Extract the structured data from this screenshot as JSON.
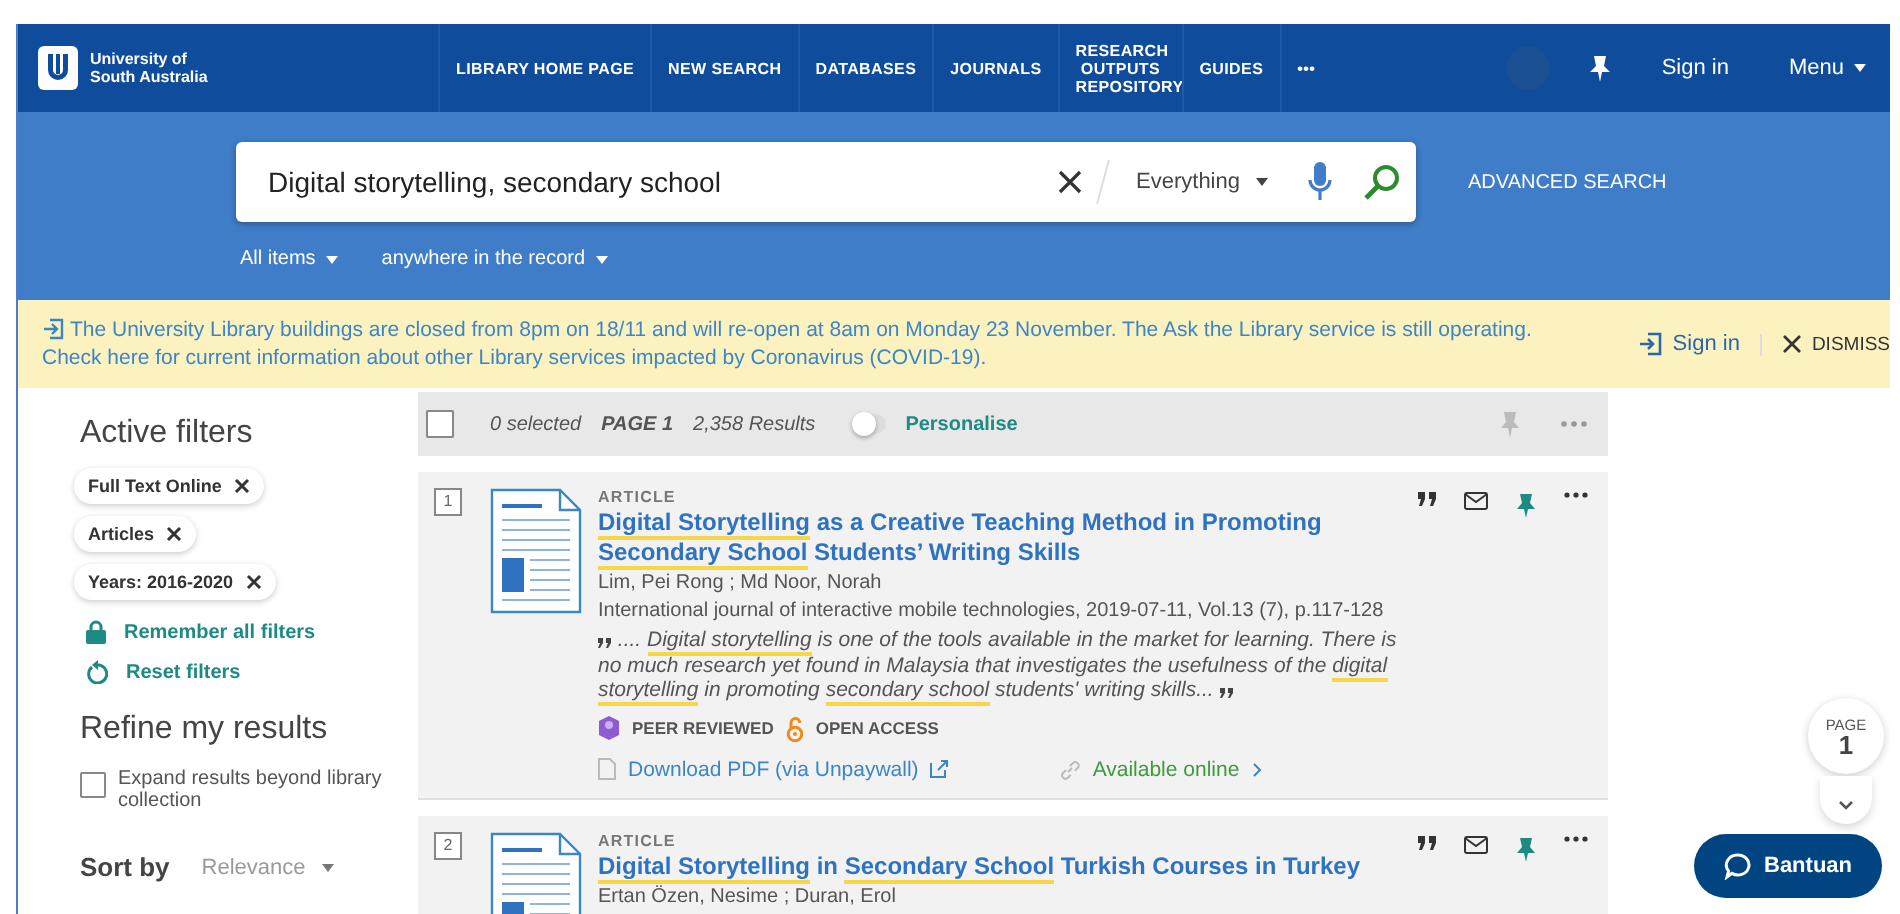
{
  "header": {
    "logo_text": "University of South Australia",
    "nav": [
      {
        "label": "LIBRARY HOME PAGE"
      },
      {
        "label": "NEW SEARCH"
      },
      {
        "label": "DATABASES"
      },
      {
        "label": "JOURNALS"
      },
      {
        "label": "RESEARCH OUTPUTS REPOSITORY"
      },
      {
        "label": "GUIDES"
      },
      {
        "label": "•••"
      }
    ],
    "sign_in": "Sign in",
    "menu": "Menu"
  },
  "search": {
    "value": "Digital storytelling, secondary school",
    "scope": "Everything",
    "advanced": "ADVANCED SEARCH",
    "filters": [
      "All items",
      "anywhere in the record"
    ]
  },
  "notice": {
    "text": "The University Library buildings are closed from 8pm on 18/11 and will re-open at 8am on Monday 23 November. The Ask the Library service is still operating. Check here for current information about other Library services impacted by Coronavirus (COVID-19).",
    "sign_in": "Sign in",
    "dismiss": "DISMISS"
  },
  "sidebar": {
    "active_title": "Active filters",
    "chips": [
      "Full Text Online",
      "Articles",
      "Years: 2016-2020"
    ],
    "remember": "Remember all filters",
    "reset": "Reset filters",
    "refine_title": "Refine my results",
    "expand": {
      "label": "Expand results beyond library collection",
      "checked": false
    },
    "sort_label": "Sort by",
    "sort_value": "Relevance"
  },
  "toolbar": {
    "select_all": {
      "checked": false
    },
    "selected": "0 selected",
    "page": "PAGE 1",
    "results": "2,358 Results",
    "personalise": {
      "label": "Personalise",
      "on": false
    }
  },
  "results": [
    {
      "number": "1",
      "type": "ARTICLE",
      "title": [
        {
          "text": "Digital Storytelling",
          "highlighted": true
        },
        {
          "text": " as a Creative Teaching Method in Promoting ",
          "highlighted": false
        },
        {
          "text": "Secondary School",
          "highlighted": true
        },
        {
          "text": " Students’ Writing Skills",
          "highlighted": false
        }
      ],
      "authors": "Lim, Pei Rong ; Md Noor, Norah",
      "source": "International journal of interactive mobile technologies, 2019-07-11, Vol.13 (7), p.117-128",
      "snippet": [
        {
          "text": ".... ",
          "highlighted": false
        },
        {
          "text": "Digital storytelling",
          "highlighted": true
        },
        {
          "text": " is one of the tools available in the market for learning. There is no much research yet found in Malaysia that investigates the usefulness of the ",
          "highlighted": false
        },
        {
          "text": "digital storytelling",
          "highlighted": true
        },
        {
          "text": " in promoting ",
          "highlighted": false
        },
        {
          "text": "secondary school",
          "highlighted": true
        },
        {
          "text": " students' writing skills...",
          "highlighted": false
        }
      ],
      "badges": [
        {
          "label": "PEER REVIEWED",
          "kind": "peer"
        },
        {
          "label": "OPEN ACCESS",
          "kind": "open"
        }
      ],
      "download": "Download PDF (via Unpaywall)",
      "availability": "Available online"
    },
    {
      "number": "2",
      "type": "ARTICLE",
      "title": [
        {
          "text": "Digital Storytelling",
          "highlighted": true
        },
        {
          "text": " in ",
          "highlighted": false
        },
        {
          "text": "Secondary School",
          "highlighted": true
        },
        {
          "text": " Turkish Courses in Turkey",
          "highlighted": false
        }
      ],
      "authors": "Ertan Özen, Nesime ; Duran, Erol"
    }
  ],
  "page_indicator": {
    "label": "PAGE",
    "number": "1"
  },
  "chat": {
    "label": "Bantuan"
  }
}
